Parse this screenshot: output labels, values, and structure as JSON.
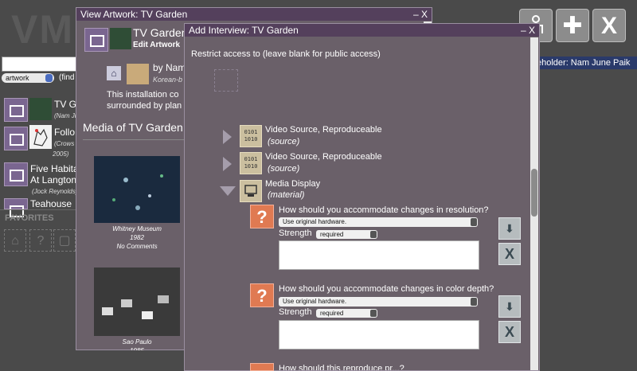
{
  "app": {
    "logo": "VM",
    "search_placeholder": "",
    "type_select": "artwork",
    "find_label": "(find",
    "stakeholder": "eholder: Nam June Paik"
  },
  "toolbar": {
    "icon_names": [
      "person-chair-icon",
      "plus-icon",
      "close-icon"
    ],
    "plus_label": "✚",
    "close_label": "X"
  },
  "list": [
    {
      "title": "TV G",
      "subtitle": "(Nam Ju"
    },
    {
      "title": "Follo",
      "subtitle": "(Crows",
      "subtitle2": "2005)"
    },
    {
      "title": "Five Habita",
      "title2": "At Langton",
      "subtitle": "(Jock Reynolds)"
    },
    {
      "title": "Teahouse",
      "subtitle": ""
    }
  ],
  "favorites": {
    "label": "FAVORITES"
  },
  "artwork_window": {
    "title": "View Artwork: TV Garden",
    "controls": "– X",
    "artwork_title": "TV Garden",
    "edit_label": "Edit Artwork",
    "by_label": "by Nam",
    "artist_origin": "Korean-b",
    "description_line1": "This installation co",
    "description_line2": "surrounded by plan",
    "media_heading": "Media of TV Garden",
    "media": [
      {
        "location": "Whitney Museum",
        "year": "1982",
        "comments": "No Comments"
      },
      {
        "location": "Sao Paulo",
        "year": "1985"
      }
    ]
  },
  "interview_window": {
    "title": "Add Interview: TV Garden",
    "controls": "– X",
    "restrict_label": "Restrict access to (leave blank for public access)",
    "components": [
      {
        "title": "Video Source, Reproduceable",
        "sub": "(source)",
        "expanded": false,
        "icon": "binary-source-icon"
      },
      {
        "title": "Video Source, Reproduceable",
        "sub": "(source)",
        "expanded": false,
        "icon": "binary-source-icon"
      },
      {
        "title": "Media Display",
        "sub": "(material)",
        "expanded": true,
        "icon": "display-icon"
      }
    ],
    "questions": [
      {
        "text": "How should you accommodate changes in resolution?",
        "answer": "Use original hardware.",
        "strength_label": "Strength",
        "strength": "required"
      },
      {
        "text": "How should you accommodate changes in color depth?",
        "answer": "Use original hardware.",
        "strength_label": "Strength",
        "strength": "required"
      },
      {
        "text": "How should this reproduce pr...?"
      }
    ],
    "question_icon_label": "?",
    "delete_label": "X",
    "save_icon_label": "⬇"
  }
}
